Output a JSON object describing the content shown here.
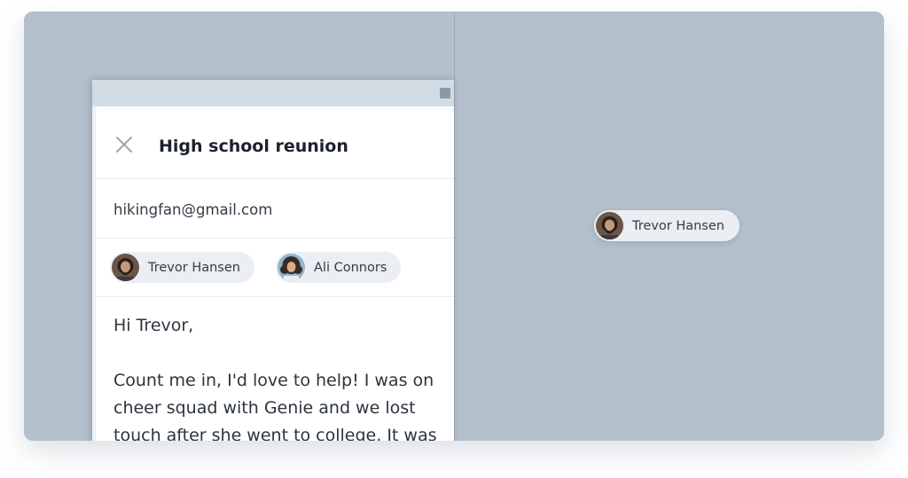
{
  "compose": {
    "title": "High school reunion",
    "from_email": "hikingfan@gmail.com",
    "recipients": [
      {
        "name": "Trevor Hansen",
        "avatar_icon": "man-beard-avatar"
      },
      {
        "name": "Ali Connors",
        "avatar_icon": "woman-curly-hair-avatar"
      }
    ],
    "body": "Hi Trevor,\n\nCount me in, I'd love to help! I was on cheer squad with Genie and we lost touch after she went to college. It was"
  },
  "dragged_chip": {
    "name": "Trevor Hansen",
    "avatar_icon": "man-beard-avatar"
  },
  "colors": {
    "stage_bg": "#b3bfcb",
    "chip_bg": "#ebeef2",
    "device_bar": "#d2dce4",
    "text_dark": "#1b222b"
  }
}
